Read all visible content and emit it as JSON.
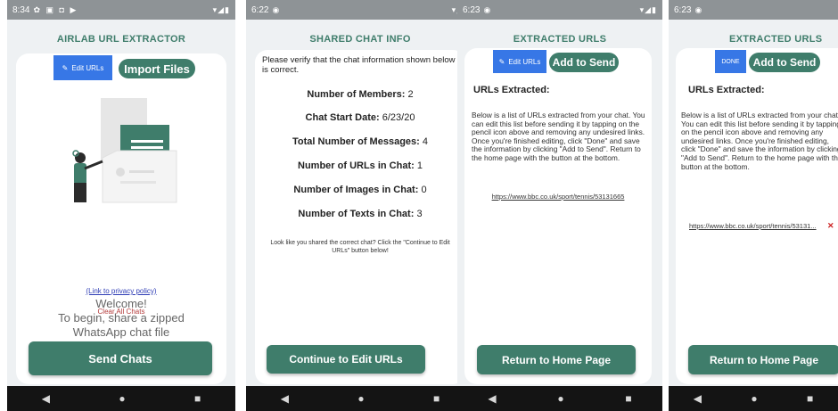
{
  "screens": [
    {
      "time": "8:34",
      "status_icons": "✿ ▣ ◘ ▶",
      "status_right": "▾◢▮",
      "title": "AIRLAB URL EXTRACTOR",
      "edit_label": "Edit URLs",
      "import_label": "Import Files",
      "welcome_lines": [
        "Welcome!",
        "To begin, share a zipped",
        "WhatsApp chat file"
      ],
      "privacy_link": "(Link to privacy policy)",
      "clear_label": "Clear All Chats",
      "send_label": "Send Chats"
    },
    {
      "time": "6:22",
      "status_icons": "◉",
      "status_right": "▾◢▮",
      "title": "SHARED CHAT INFO",
      "verify_text": "Please verify that the chat information shown below is correct.",
      "stats": [
        {
          "label": "Number of Members:",
          "value": "2"
        },
        {
          "label": "Chat Start Date:",
          "value": "6/23/20"
        },
        {
          "label": "Total Number of Messages:",
          "value": "4"
        },
        {
          "label": "Number of URLs in Chat:",
          "value": "1"
        },
        {
          "label": "Number of Images in Chat:",
          "value": "0"
        },
        {
          "label": "Number of Texts in Chat:",
          "value": "3"
        }
      ],
      "look_text": "Look like you shared the correct chat? Click the \"Continue to Edit URLs\" button below!",
      "continue_label": "Continue to Edit URLs"
    },
    {
      "time": "6:23",
      "status_icons": "◉",
      "status_right": "▾◢▮",
      "title": "EXTRACTED URLS",
      "edit_label": "Edit URLs",
      "add_label": "Add to Send",
      "heading": "URLs Extracted:",
      "desc": "Below is a list of URLs extracted from your chat. You can edit this list before sending it by tapping on the pencil icon above and removing any undesired links. Once you're finished editing, click \"Done\" and save the information by clicking \"Add to Send\". Return to the home page with the button at the bottom.",
      "url": "https://www.bbc.co.uk/sport/tennis/53131665",
      "home_label": "Return to Home Page"
    },
    {
      "time": "6:23",
      "status_icons": "◉",
      "title": "EXTRACTED URLS",
      "done_label": "DONE",
      "add_label": "Add to Send",
      "heading": "URLs Extracted:",
      "desc": "Below is a list of URLs extracted from your chat. You can edit this list before sending it by tapping on the pencil icon above and removing any undesired links. Once you're finished editing, click \"Done\" and save the information by clicking \"Add to Send\". Return to the home page with the button at the bottom.",
      "url": "https://www.bbc.co.uk/sport/tennis/53131...",
      "remove_icon": "✕",
      "home_label": "Return to Home Page"
    }
  ],
  "nav": {
    "back": "◀",
    "home": "●",
    "recents": "■"
  },
  "colors": {
    "green": "#3f7d6b",
    "blue": "#3777e6",
    "status_bar": "#8e9396"
  }
}
